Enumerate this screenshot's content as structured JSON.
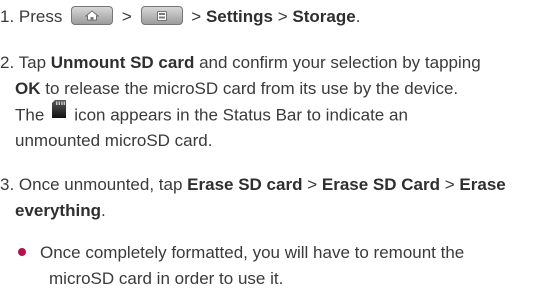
{
  "step1": {
    "num": "1.",
    "press": "Press",
    "sep1": ">",
    "sep2": ">",
    "settings": "Settings",
    "sep3": ">",
    "storage": "Storage",
    "end": ".",
    "home_key_icon": "home-key-icon",
    "menu_key_icon": "menu-key-icon"
  },
  "step2": {
    "num": "2.",
    "tap": "Tap",
    "unmount": "Unmount SD card",
    "mid1": "and confirm your selection by tapping",
    "ok": "OK",
    "mid2": "to release the microSD card from its use by the device.",
    "the": "The",
    "mid3": "icon appears in the Status Bar to indicate an",
    "line4": "unmounted microSD card.",
    "sd_icon": "sd-card-icon"
  },
  "step3": {
    "num": "3.",
    "lead": "Once unmounted, tap",
    "erase_sd": "Erase SD card",
    "sep1": ">",
    "erase_sd2": "Erase SD Card",
    "sep2": ">",
    "erase": "Erase",
    "everything": "everything",
    "end": "."
  },
  "note": {
    "line1": "Once completely formatted, you will have to remount the",
    "line2": "microSD card in order to use it."
  },
  "colors": {
    "text": "#3a3a3a",
    "bullet": "#b5124f"
  }
}
